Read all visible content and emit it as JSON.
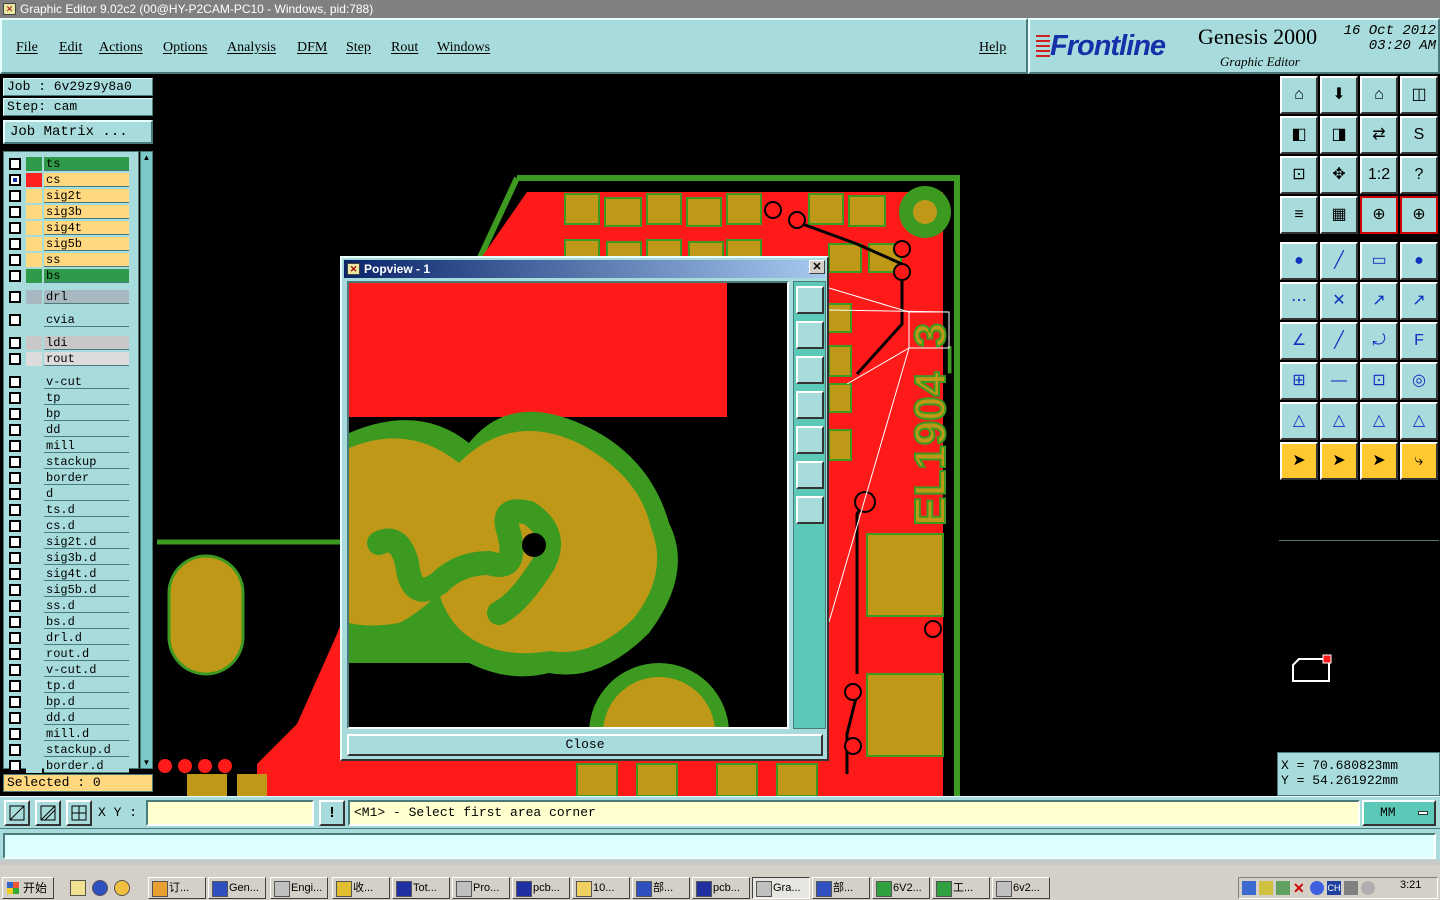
{
  "window": {
    "title": "Graphic Editor 9.02c2 (00@HY-P2CAM-PC10 - Windows, pid:788)"
  },
  "menu": {
    "items": [
      "File",
      "Edit",
      "Actions",
      "Options",
      "Analysis",
      "DFM",
      "Step",
      "Rout",
      "Windows"
    ],
    "help": "Help"
  },
  "brand": {
    "logo": "Frontline",
    "product": "Genesis 2000",
    "subtitle": "Graphic Editor",
    "date": "16 Oct 2012",
    "time": "03:20 AM"
  },
  "job": {
    "job_label": "Job : 6v29z9y8a0",
    "step_label": "Step: cam",
    "matrix_button": "Job Matrix ..."
  },
  "layers": [
    {
      "name": "ts",
      "color": "#2f9a4a",
      "swatch": "#2f9a4a",
      "checked": false
    },
    {
      "name": "cs",
      "color": "#ffd880",
      "swatch": "#ff2020",
      "checked": true
    },
    {
      "name": "sig2t",
      "color": "#ffd880",
      "swatch": "",
      "checked": false
    },
    {
      "name": "sig3b",
      "color": "#ffd880",
      "swatch": "",
      "checked": false
    },
    {
      "name": "sig4t",
      "color": "#ffd880",
      "swatch": "",
      "checked": false
    },
    {
      "name": "sig5b",
      "color": "#ffd880",
      "swatch": "",
      "checked": false
    },
    {
      "name": "ss",
      "color": "#ffd880",
      "swatch": "",
      "checked": false
    },
    {
      "name": "bs",
      "color": "#2f9a4a",
      "swatch": "",
      "checked": false
    },
    {
      "name": "drl",
      "color": "#a8b8c0",
      "swatch": "",
      "checked": false
    },
    {
      "name": "cvia",
      "color": "#a8dcdc",
      "swatch": "",
      "checked": false
    },
    {
      "name": "ldi",
      "color": "#c8c8c8",
      "swatch": "",
      "checked": false
    },
    {
      "name": "rout",
      "color": "#dcdcdc",
      "swatch": "",
      "checked": false
    },
    {
      "name": "v-cut",
      "color": "#a8dcdc",
      "swatch": "",
      "checked": false
    },
    {
      "name": "tp",
      "color": "#a8dcdc",
      "swatch": "",
      "checked": false
    },
    {
      "name": "bp",
      "color": "#a8dcdc",
      "swatch": "",
      "checked": false
    },
    {
      "name": "dd",
      "color": "#a8dcdc",
      "swatch": "",
      "checked": false
    },
    {
      "name": "mill",
      "color": "#a8dcdc",
      "swatch": "",
      "checked": false
    },
    {
      "name": "stackup",
      "color": "#a8dcdc",
      "swatch": "",
      "checked": false
    },
    {
      "name": "border",
      "color": "#a8dcdc",
      "swatch": "",
      "checked": false
    },
    {
      "name": "d",
      "color": "#a8dcdc",
      "swatch": "",
      "checked": false
    },
    {
      "name": "ts.d",
      "color": "#a8dcdc",
      "swatch": "",
      "checked": false
    },
    {
      "name": "cs.d",
      "color": "#a8dcdc",
      "swatch": "",
      "checked": false
    },
    {
      "name": "sig2t.d",
      "color": "#a8dcdc",
      "swatch": "",
      "checked": false
    },
    {
      "name": "sig3b.d",
      "color": "#a8dcdc",
      "swatch": "",
      "checked": false
    },
    {
      "name": "sig4t.d",
      "color": "#a8dcdc",
      "swatch": "",
      "checked": false
    },
    {
      "name": "sig5b.d",
      "color": "#a8dcdc",
      "swatch": "",
      "checked": false
    },
    {
      "name": "ss.d",
      "color": "#a8dcdc",
      "swatch": "",
      "checked": false
    },
    {
      "name": "bs.d",
      "color": "#a8dcdc",
      "swatch": "",
      "checked": false
    },
    {
      "name": "drl.d",
      "color": "#a8dcdc",
      "swatch": "",
      "checked": false
    },
    {
      "name": "rout.d",
      "color": "#a8dcdc",
      "swatch": "",
      "checked": false
    },
    {
      "name": "v-cut.d",
      "color": "#a8dcdc",
      "swatch": "",
      "checked": false
    },
    {
      "name": "tp.d",
      "color": "#a8dcdc",
      "swatch": "",
      "checked": false
    },
    {
      "name": "bp.d",
      "color": "#a8dcdc",
      "swatch": "",
      "checked": false
    },
    {
      "name": "dd.d",
      "color": "#a8dcdc",
      "swatch": "",
      "checked": false
    },
    {
      "name": "mill.d",
      "color": "#a8dcdc",
      "swatch": "",
      "checked": false
    },
    {
      "name": "stackup.d",
      "color": "#a8dcdc",
      "swatch": "",
      "checked": false
    },
    {
      "name": "border.d",
      "color": "#a8dcdc",
      "swatch": "",
      "checked": false
    }
  ],
  "selected_label": "Selected : 0",
  "canvas": {
    "silkscreen_text": "EL1904_3"
  },
  "popview": {
    "title": "Popview - 1",
    "close_label": "Close"
  },
  "coords": {
    "x": "X  =  70.680823mm",
    "y": "Y  =  54.261922mm"
  },
  "bottom": {
    "xy_label": "X Y :",
    "xy_value": "",
    "prompt": "<M1> - Select first area corner",
    "units": "MM"
  },
  "taskbar": {
    "start": "开始",
    "tasks": [
      "订...",
      "Gen...",
      "Engi...",
      "收...",
      "Tot...",
      "Pro...",
      "pcb...",
      "10...",
      "部...",
      "pcb...",
      "Gra...",
      "部...",
      "6V2...",
      "工...",
      "6v2..."
    ],
    "clock": "3:21"
  },
  "colors": {
    "panel": "#a8dcdc",
    "copper": "#ff1a1a",
    "pad": "#c09818",
    "outline": "#3c9a20",
    "mask": "#3c9a20"
  }
}
